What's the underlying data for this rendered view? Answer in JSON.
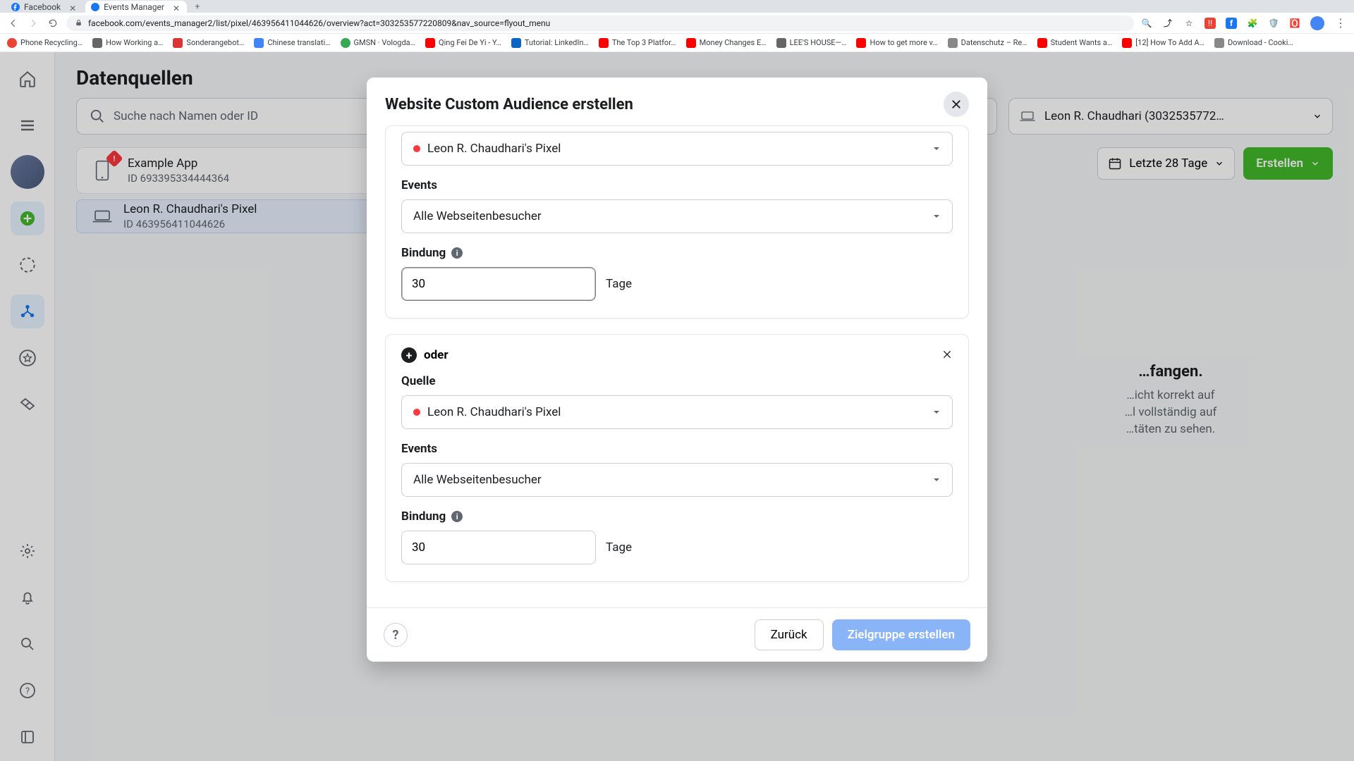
{
  "browser": {
    "tabs": [
      {
        "title": "Facebook"
      },
      {
        "title": "Events Manager"
      }
    ],
    "url": "facebook.com/events_manager2/list/pixel/463956411044626/overview?act=303253577220809&nav_source=flyout_menu",
    "lock_icon": "lock-icon"
  },
  "bookmarks": [
    "Phone Recycling…",
    "How Working a…",
    "Sonderangebot…",
    "Chinese translati…",
    "GMSN · Vologda…",
    "Qing Fei De Yi - Y…",
    "Tutorial: LinkedIn…",
    "The Top 3 Platfor…",
    "Money Changes E…",
    "LEE'S HOUSE—…",
    "How to get more v…",
    "Datenschutz – Re…",
    "Student Wants a…",
    "[12] How To Add A…",
    "Download - Cooki…"
  ],
  "page": {
    "title": "Datenquellen",
    "search_placeholder": "Suche nach Namen oder ID",
    "account_name": "Leon R. Chaudhari (3032535772…",
    "date_range": "Letzte 28 Tage",
    "create_btn": "Erstellen",
    "sources": [
      {
        "name": "Example App",
        "id": "ID 693395334444364",
        "warn": true,
        "icon": "phone"
      },
      {
        "name": "Leon R. Chaudhari's Pixel",
        "id": "ID 463956411044626",
        "icon": "laptop",
        "selected": true
      }
    ],
    "right_heading": "…fangen.",
    "right_body1": "…icht korrekt auf",
    "right_body2": "…l vollständig auf",
    "right_body3": "…täten zu sehen."
  },
  "modal": {
    "title": "Website Custom Audience erstellen",
    "pixel_name": "Leon R. Chaudhari's Pixel",
    "events_label": "Events",
    "events_value": "Alle Webseitenbesucher",
    "binding_label": "Bindung",
    "binding_value": "30",
    "days": "Tage",
    "oder": "oder",
    "quelle_label": "Quelle",
    "back_btn": "Zurück",
    "create_btn": "Zielgruppe erstellen"
  }
}
